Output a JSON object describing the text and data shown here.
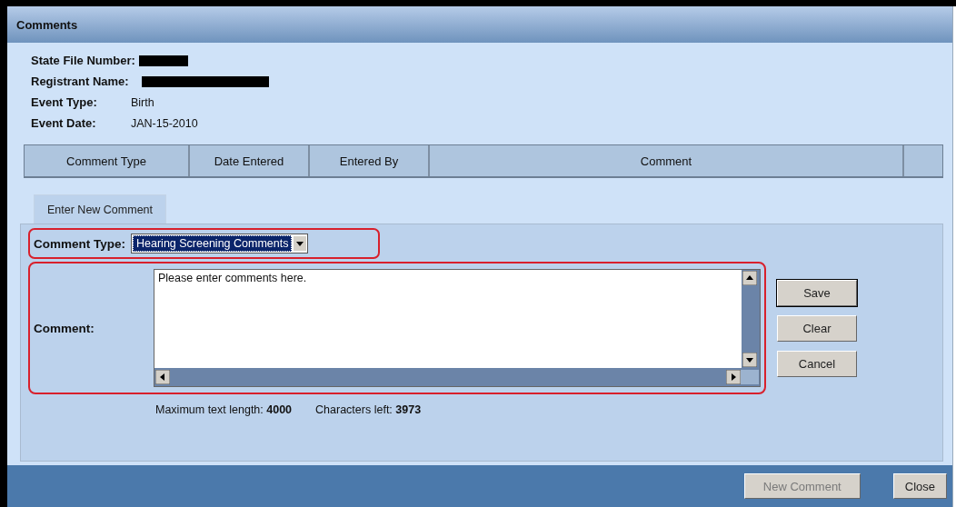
{
  "window": {
    "title": "Comments"
  },
  "record_fields": [
    {
      "label": "State File Number:",
      "redacted": true
    },
    {
      "label": "Registrant Name:",
      "redacted": true
    },
    {
      "label": "Event Type:",
      "value": "Birth",
      "redacted": false
    },
    {
      "label": "Event Date:",
      "value": "JAN-15-2010",
      "redacted": false
    }
  ],
  "table": {
    "columns": [
      "Comment Type",
      "Date Entered",
      "Entered By",
      "Comment"
    ]
  },
  "tabs": [
    {
      "label": "Enter New Comment",
      "selected": true
    }
  ],
  "form": {
    "comment_type": {
      "label": "Comment Type:",
      "value": "Hearing Screening Comments",
      "highlighted": true
    },
    "comment": {
      "label": "Comment:",
      "value": "Please enter comments here.",
      "highlighted": true
    },
    "max_length": "Maximum text length: **4000**",
    "chars_left": "Characters left: **3973**",
    "buttons": [
      {
        "label": "Save",
        "default": true
      },
      {
        "label": "Clear",
        "default": false
      },
      {
        "label": "Cancel",
        "default": false
      }
    ]
  },
  "footer_buttons": [
    {
      "label": "New Comment",
      "disabled": true
    },
    {
      "label": "Close",
      "disabled": false
    }
  ]
}
